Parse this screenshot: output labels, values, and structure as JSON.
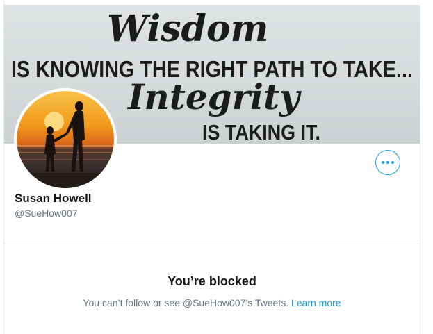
{
  "banner": {
    "line1": "Wisdom",
    "line2": "IS KNOWING THE RIGHT PATH TO TAKE...",
    "line3": "Integrity",
    "line4": "IS TAKING IT."
  },
  "profile": {
    "name": "Susan Howell",
    "handle": "@SueHow007"
  },
  "blocked": {
    "title": "You’re blocked",
    "message": "You can’t follow or see @SueHow007’s Tweets.",
    "link": "Learn more"
  },
  "colors": {
    "accent": "#1da1f2",
    "text": "#14171a",
    "secondary_text": "#657786",
    "border": "#e6ecf0"
  },
  "icons": {
    "more": "more-horizontal-icon"
  }
}
